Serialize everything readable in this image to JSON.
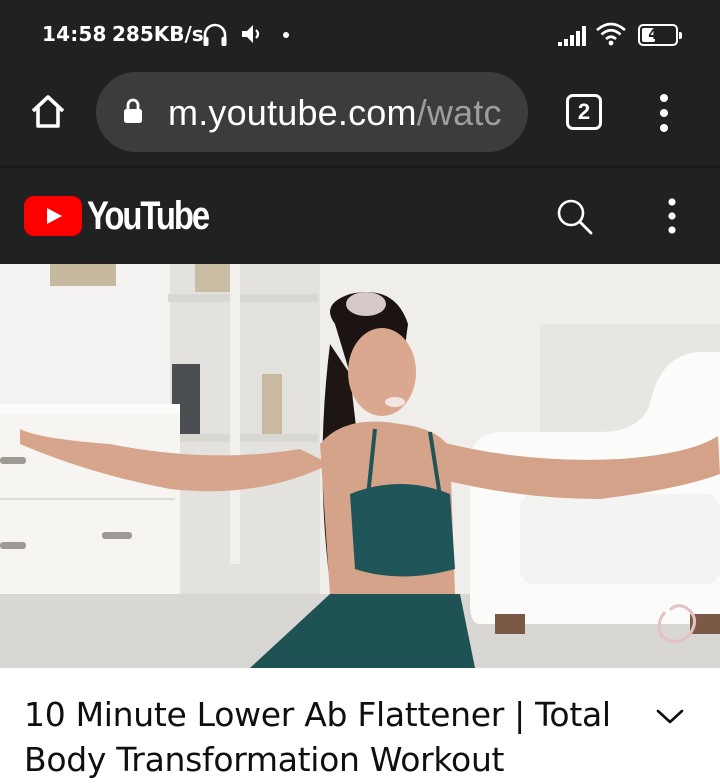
{
  "status_bar": {
    "time": "14:58",
    "network_speed": "285KB/s",
    "battery_level": "41",
    "battery_fraction": 0.41,
    "icons": [
      "headphone-icon",
      "volume-icon",
      "notification-dot",
      "signal-icon",
      "wifi-icon",
      "battery-icon"
    ]
  },
  "browser": {
    "url_domain": "m.youtube.com",
    "url_path": "/watc",
    "tab_count": "2",
    "icons": [
      "home-icon",
      "lock-icon",
      "tabs-icon",
      "more-vert-icon"
    ]
  },
  "youtube": {
    "logo_text": "YouTube",
    "icons": [
      "youtube-play-logo",
      "search-icon",
      "more-vert-icon"
    ],
    "colors": {
      "brand_red": "#ff0000",
      "header_bg": "#212121"
    }
  },
  "video": {
    "title": "10 Minute Lower Ab Flattener | Total Body Transformation Workout",
    "expand_icon": "chevron-down-icon"
  }
}
